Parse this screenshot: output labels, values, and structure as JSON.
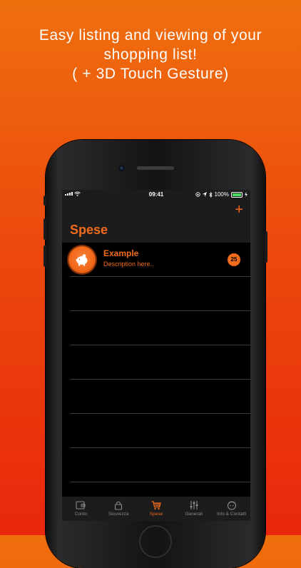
{
  "headline": {
    "line1": "Easy listing and viewing of your",
    "line2": "shopping list!",
    "line3": "( + 3D Touch Gesture)"
  },
  "status_bar": {
    "time": "09:41",
    "battery": "100%"
  },
  "nav": {
    "add_symbol": "+",
    "title": "Spese"
  },
  "items": [
    {
      "title": "Example",
      "description": "Description here..",
      "count": "25",
      "icon": "piggy-bank-icon"
    }
  ],
  "tabs": [
    {
      "label": "Conto",
      "icon": "wallet-icon",
      "active": false
    },
    {
      "label": "Sicurezza",
      "icon": "lock-icon",
      "active": false
    },
    {
      "label": "Spese",
      "icon": "cart-icon",
      "active": true
    },
    {
      "label": "Generali",
      "icon": "sliders-icon",
      "active": false
    },
    {
      "label": "Info & Contatti",
      "icon": "info-face-icon",
      "active": false
    }
  ],
  "colors": {
    "accent": "#f26a1b",
    "background_top": "#ef6f0e",
    "background_bottom": "#e9270c"
  }
}
